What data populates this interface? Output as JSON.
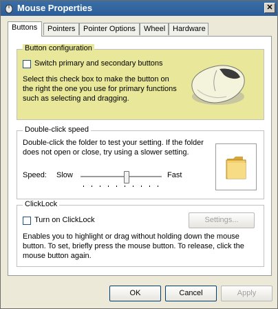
{
  "window": {
    "title": "Mouse Properties",
    "close_glyph": "✕"
  },
  "tabs": [
    {
      "label": "Buttons",
      "active": true
    },
    {
      "label": "Pointers"
    },
    {
      "label": "Pointer Options"
    },
    {
      "label": "Wheel"
    },
    {
      "label": "Hardware"
    }
  ],
  "button_config": {
    "title": "Button configuration",
    "checkbox_label": "Switch primary and secondary buttons",
    "checkbox_checked": false,
    "description": "Select this check box to make the button on the right the one you use for primary functions such as selecting and dragging.",
    "highlight_color": "#e8e79a"
  },
  "double_click": {
    "title": "Double-click speed",
    "description": "Double-click the folder to test your setting. If the folder does not open or close, try using a slower setting.",
    "speed_label": "Speed:",
    "slow_label": "Slow",
    "fast_label": "Fast",
    "speed_fraction": 0.57,
    "folder_icon": "folder-icon"
  },
  "clicklock": {
    "title": "ClickLock",
    "checkbox_label": "Turn on ClickLock",
    "checkbox_checked": false,
    "settings_button": "Settings...",
    "description": "Enables you to highlight or drag without holding down the mouse button. To set, briefly press the mouse button. To release, click the mouse button again."
  },
  "footer": {
    "ok": "OK",
    "cancel": "Cancel",
    "apply": "Apply"
  }
}
